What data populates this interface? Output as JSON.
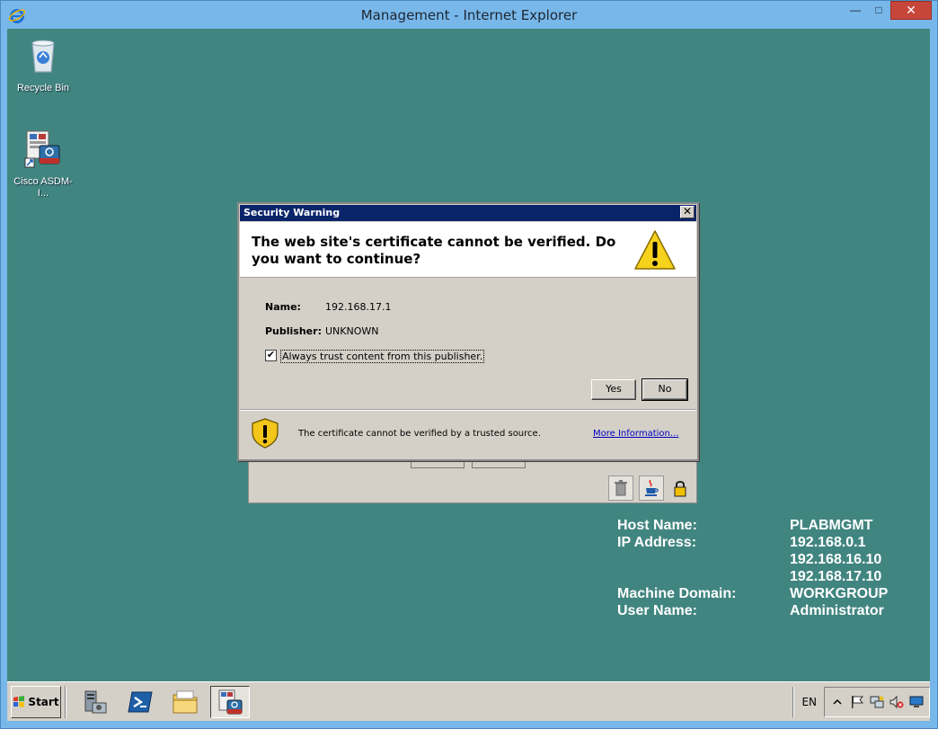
{
  "window": {
    "title": "Management - Internet Explorer",
    "controls": {
      "minimize": "—",
      "maximize": "□",
      "close": "✕"
    }
  },
  "desktop": {
    "icons": [
      {
        "label": "Recycle Bin",
        "icon": "recycle-bin-icon"
      },
      {
        "label": "Cisco ASDM-I...",
        "icon": "cisco-asdm-icon"
      }
    ],
    "info": {
      "host_name_label": "Host Name:",
      "host_name_value": "PLABMGMT",
      "ip_label": "IP Address:",
      "ip_values": [
        "192.168.0.1",
        "192.168.16.10",
        "192.168.17.10"
      ],
      "domain_label": "Machine Domain:",
      "domain_value": "WORKGROUP",
      "user_label": "User Name:",
      "user_value": "Administrator"
    }
  },
  "dialog": {
    "title": "Security Warning",
    "close": "✕",
    "question": "The web site's certificate cannot be verified.  Do you want to continue?",
    "name_label": "Name:",
    "name_value": "192.168.17.1",
    "publisher_label": "Publisher:",
    "publisher_value": "UNKNOWN",
    "checkbox_label": "Always trust content from this publisher.",
    "checkbox_checked": true,
    "checkbox_mark": "✔",
    "yes_label": "Yes",
    "no_label": "No",
    "footer_text": "The certificate cannot be verified by a trusted source.",
    "more_info_label": "More Information..."
  },
  "taskbar": {
    "start_label": "Start",
    "apps": [
      "server-manager-icon",
      "powershell-icon",
      "file-explorer-icon",
      "cisco-asdm-icon"
    ],
    "language": "EN"
  },
  "colors": {
    "desktop_bg": "#418580",
    "dialog_title_bg": "#0a246a",
    "link": "#0000c0"
  }
}
